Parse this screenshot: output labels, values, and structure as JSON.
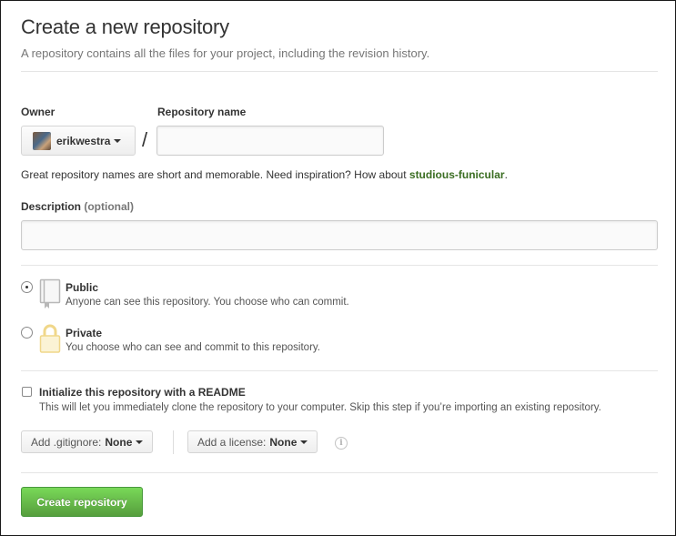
{
  "header": {
    "title": "Create a new repository",
    "subtitle": "A repository contains all the files for your project, including the revision history."
  },
  "owner": {
    "label": "Owner",
    "value": "erikwestra",
    "avatar_icon": "user-avatar"
  },
  "repository": {
    "label": "Repository name",
    "value": "",
    "separator": "/"
  },
  "hint": {
    "text": "Great repository names are short and memorable. Need inspiration? How about ",
    "suggestion": "studious-funicular",
    "end": "."
  },
  "description": {
    "label": "Description",
    "optional": "(optional)",
    "value": ""
  },
  "visibility": {
    "selected": "public",
    "public": {
      "title": "Public",
      "desc": "Anyone can see this repository. You choose who can commit.",
      "icon": "repo-book-icon"
    },
    "private": {
      "title": "Private",
      "desc": "You choose who can see and commit to this repository.",
      "icon": "lock-icon"
    }
  },
  "readme": {
    "checked": false,
    "title": "Initialize this repository with a README",
    "desc": "This will let you immediately clone the repository to your computer. Skip this step if you’re importing an existing repository."
  },
  "gitignore": {
    "label": "Add .gitignore:",
    "value": "None"
  },
  "license": {
    "label": "Add a license:",
    "value": "None"
  },
  "info_icon": "i",
  "submit": {
    "label": "Create repository"
  },
  "colors": {
    "accent_green": "#569e3d",
    "link_green": "#3b6e22",
    "private_lock": "#f0d78a"
  }
}
